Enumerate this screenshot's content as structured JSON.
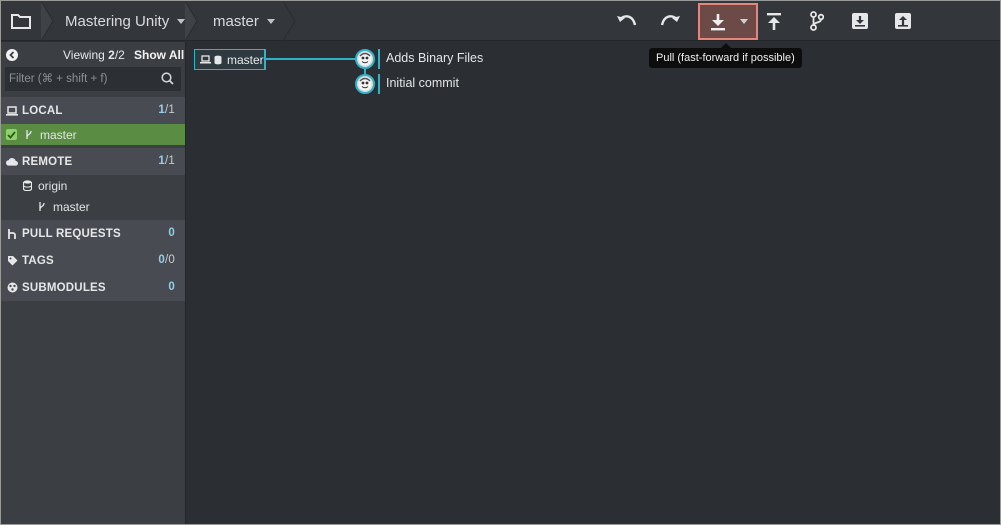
{
  "toolbar": {
    "repo_name": "Mastering Unity",
    "branch_name": "master",
    "buttons": [
      "folder-icon",
      "undo-icon",
      "redo-icon",
      "pull-icon",
      "push-icon",
      "branch-icon",
      "stash-icon",
      "pop-icon"
    ],
    "tooltip": "Pull (fast-forward if possible)"
  },
  "sidebar": {
    "viewing_label": "Viewing",
    "viewing_count": "2",
    "viewing_total": "/2",
    "show_all": "Show All",
    "filter_placeholder": "Filter (⌘ + shift + f)",
    "local": {
      "label": "LOCAL",
      "count": "1",
      "total": "/1",
      "branches": [
        "master"
      ]
    },
    "remote": {
      "label": "REMOTE",
      "count": "1",
      "total": "/1",
      "remote_name": "origin",
      "branches": [
        "master"
      ]
    },
    "pull_requests": {
      "label": "PULL REQUESTS",
      "count": "0"
    },
    "tags": {
      "label": "TAGS",
      "count": "0",
      "total": "/0"
    },
    "submodules": {
      "label": "SUBMODULES",
      "count": "0"
    }
  },
  "graph": {
    "branch_label": "master",
    "commits": [
      "Adds Binary Files",
      "Initial commit"
    ]
  },
  "colors": {
    "accent": "#2fb3c9",
    "highlight": "#e8857a",
    "active_branch": "#5b8c43"
  }
}
